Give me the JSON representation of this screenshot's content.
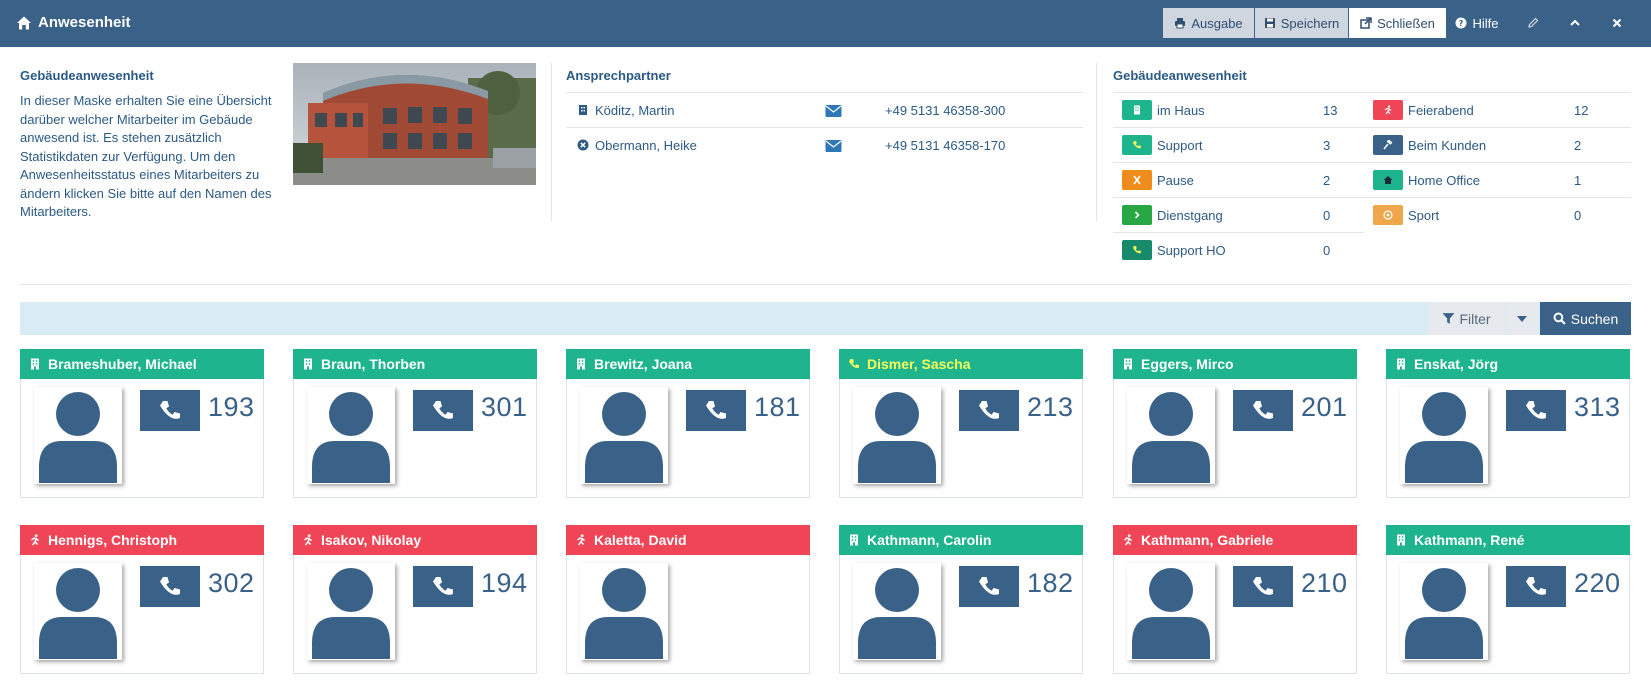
{
  "header": {
    "title": "Anwesenheit",
    "buttons": {
      "ausgabe": "Ausgabe",
      "speichern": "Speichern",
      "schliessen": "Schließen",
      "hilfe": "Hilfe"
    }
  },
  "info": {
    "title": "Gebäudeanwesenheit",
    "description": "In dieser Maske erhalten Sie eine Übersicht darüber welcher Mitarbeiter im Gebäude anwesend ist. Es stehen zusätzlich Statistikdaten zur Verfügung. Um den Anwesenheitsstatus eines Mitarbeiters zu ändern klicken Sie bitte auf den Namen des Mitarbeiters."
  },
  "contacts": {
    "title": "Ansprechpartner",
    "items": [
      {
        "name": "Köditz, Martin",
        "phone": "+49 5131 46358-300",
        "icon": "building-icon"
      },
      {
        "name": "Obermann, Heike",
        "phone": "+49 5131 46358-170",
        "icon": "cancel-circle-icon"
      }
    ]
  },
  "stats": {
    "title": "Gebäudeanwesenheit",
    "colors": {
      "im_haus": "#1eb48e",
      "support": "#1eb48e",
      "pause": "#f08c1e",
      "dienstgang": "#28a745",
      "support_ho": "#178a6c",
      "feierabend": "#ef4556",
      "beim_kunden": "#3a6188",
      "home_office": "#1eb48e",
      "sport": "#f0a64a"
    },
    "left": [
      {
        "label": "im Haus",
        "count": "13"
      },
      {
        "label": "Support",
        "count": "3"
      },
      {
        "label": "Pause",
        "count": "2"
      },
      {
        "label": "Dienstgang",
        "count": "0"
      },
      {
        "label": "Support HO",
        "count": "0"
      }
    ],
    "right": [
      {
        "label": "Feierabend",
        "count": "12"
      },
      {
        "label": "Beim Kunden",
        "count": "2"
      },
      {
        "label": "Home Office",
        "count": "1"
      },
      {
        "label": "Sport",
        "count": "0"
      }
    ]
  },
  "toolbar": {
    "filter": "Filter",
    "search": "Suchen"
  },
  "employees": [
    {
      "name": "Brameshuber, Michael",
      "ext": "193",
      "status": "im Haus"
    },
    {
      "name": "Braun, Thorben",
      "ext": "301",
      "status": "im Haus"
    },
    {
      "name": "Brewitz, Joana",
      "ext": "181",
      "status": "im Haus"
    },
    {
      "name": "Dismer, Sascha",
      "ext": "213",
      "status": "Support"
    },
    {
      "name": "Eggers, Mirco",
      "ext": "201",
      "status": "im Haus"
    },
    {
      "name": "Enskat, Jörg",
      "ext": "313",
      "status": "im Haus"
    },
    {
      "name": "Hennigs, Christoph",
      "ext": "302",
      "status": "Feierabend"
    },
    {
      "name": "Isakov, Nikolay",
      "ext": "194",
      "status": "Feierabend"
    },
    {
      "name": "Kaletta, David",
      "ext": "",
      "status": "Feierabend"
    },
    {
      "name": "Kathmann, Carolin",
      "ext": "182",
      "status": "im Haus"
    },
    {
      "name": "Kathmann, Gabriele",
      "ext": "210",
      "status": "Feierabend"
    },
    {
      "name": "Kathmann, René",
      "ext": "220",
      "status": "im Haus"
    }
  ]
}
